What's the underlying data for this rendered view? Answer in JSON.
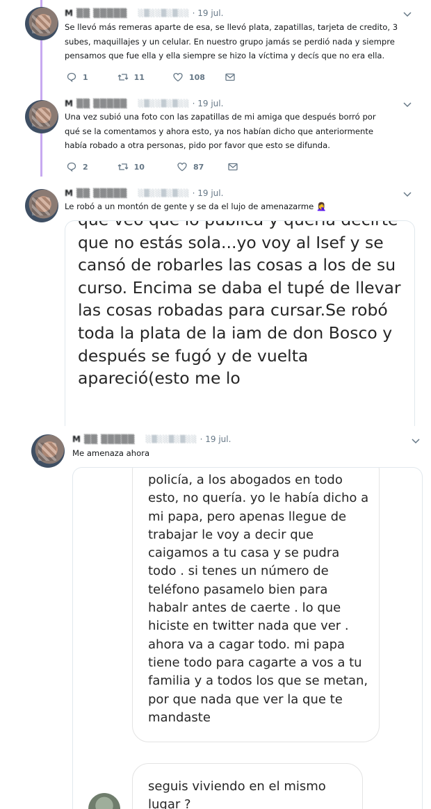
{
  "tweets": [
    {
      "date": "· 19 jul.",
      "text": "Se llevó más remeras aparte de esa, se llevó plata, zapatillas, tarjeta de credito, 3 subes, maquillajes y un celular. En nuestro grupo jamás se perdió nada y siempre pensamos que fue ella y ella siempre se hizo la víctima y decís que no era ella.",
      "replies": "1",
      "retweets": "11",
      "likes": "108"
    },
    {
      "date": "· 19 jul.",
      "text": "Una vez subió una foto con las zapatillas de mi amiga que después borró por qué se la comentamos y ahora esto, ya nos habían dicho que anteriormente había robado a otra personas, pido por favor que esto se difunda.",
      "replies": "2",
      "retweets": "10",
      "likes": "87"
    },
    {
      "date": "· 19 jul.",
      "text": "Le robó a un montón de gente y se da el lujo de amenazarme 🤦‍♀️",
      "image_text": "que veo que lo publica y quería decirte que no estás sola...yo voy al Isef y se cansó de robarles las cosas a los de su curso. Encima se daba el tupé de llevar las cosas robadas para cursar.Se robó toda la plata de la iam de don Bosco y después se fugó y de vuelta apareció(esto me lo"
    },
    {
      "date": "· 19 jul.",
      "text": "Me amenaza ahora",
      "bubble1": "policía, a los abogados en todo esto, no quería.  yo le había dicho a mi papa, pero apenas llegue de trabajar le voy a decir que caigamos a tu casa y se pudra todo . si tenes un número de teléfono pasamelo bien para habalr antes de caerte . lo que hiciste en twitter nada que ver . ahora va a cagar todo. mi papa tiene todo para cagarte a vos a tu familia y a todos los que se metan, por que nada que ver la que te mandaste",
      "bubble2": "seguis viviendo en el mismo lugar ?"
    }
  ],
  "colors": {
    "thread_line": "#c7a9f0",
    "text": "#14171a",
    "muted": "#657786"
  }
}
